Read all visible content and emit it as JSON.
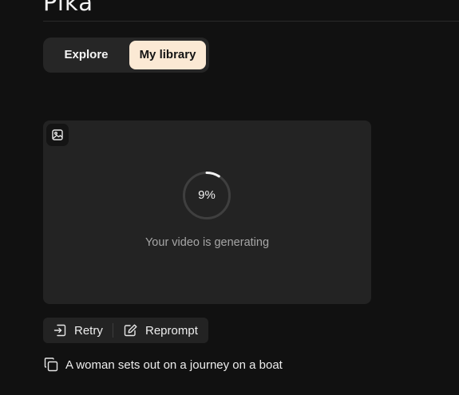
{
  "app": {
    "logo_text": "Pika"
  },
  "tabs": [
    {
      "label": "Explore",
      "active": false
    },
    {
      "label": "My library",
      "active": true
    }
  ],
  "generation": {
    "progress_text": "9%",
    "progress_fraction": 0.09,
    "status_text": "Your video is generating",
    "image_icon": "image-icon"
  },
  "actions": {
    "retry_label": "Retry",
    "retry_icon": "retry-icon",
    "reprompt_label": "Reprompt",
    "reprompt_icon": "edit-icon"
  },
  "prompt": {
    "copy_icon": "copy-icon",
    "text": "A woman sets out on a journey on a boat"
  },
  "colors": {
    "background": "#111111",
    "active_tab_bg": "#fbe9d4",
    "card_bg": "#232323"
  }
}
